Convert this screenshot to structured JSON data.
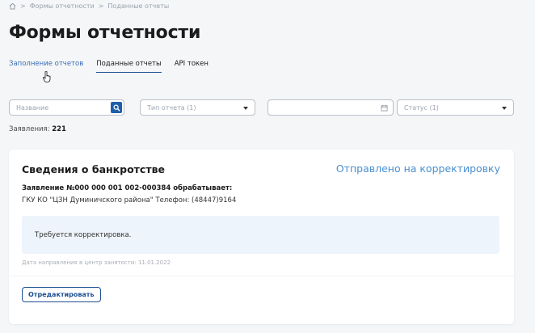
{
  "breadcrumb": {
    "icon": "home-icon",
    "items": [
      "Формы отчетности",
      "Поданные отчеты"
    ],
    "separator": ">"
  },
  "page": {
    "title": "Формы отчетности"
  },
  "tabs": [
    {
      "label": "Заполнение отчетов",
      "active": false
    },
    {
      "label": "Поданные отчеты",
      "active": true
    },
    {
      "label": "API токен",
      "active": false
    }
  ],
  "filters": {
    "name_placeholder": "Название",
    "type_placeholder": "Тип отчета (1)",
    "date_value": "",
    "status_placeholder": "Статус (1)"
  },
  "count": {
    "label": "Заявления:",
    "value": "221"
  },
  "card": {
    "title": "Сведения о банкротстве",
    "status": "Отправлено на корректировку",
    "application_line": "Заявление №000 000 001 002-000384 обрабатывает:",
    "organization_line": "ГКУ КО \"ЦЗН Думиничского района\" Телефон: (48447)9164",
    "notice": "Требуется корректировка.",
    "sent_date": "Дата направления в центр занятости: 11.01.2022",
    "edit_label": "Отредактировать"
  },
  "colors": {
    "accent": "#1d4f91",
    "status": "#4a8fd0",
    "notice_bg": "#eef4fb",
    "page_bg": "#f4f6f8"
  }
}
